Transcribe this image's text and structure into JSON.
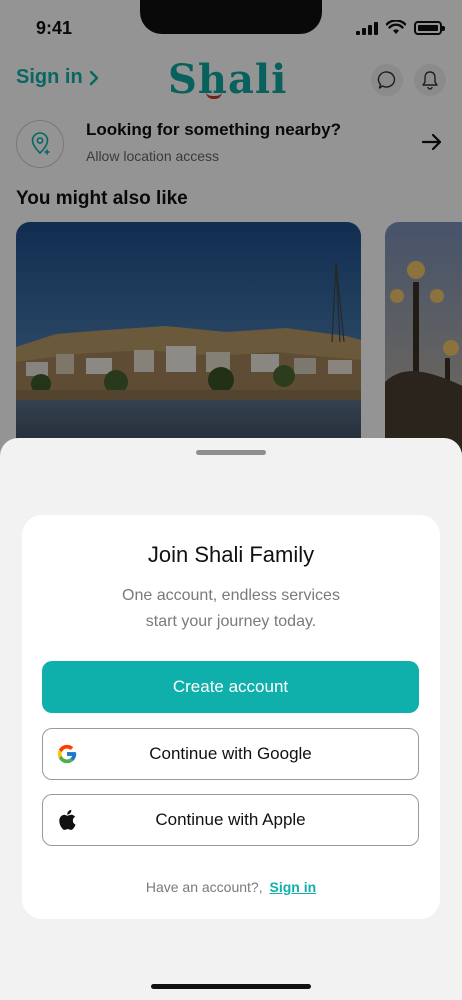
{
  "status": {
    "time": "9:41"
  },
  "header": {
    "signin_label": "Sign in",
    "logo_text": "Shali"
  },
  "location": {
    "title": "Looking for something nearby?",
    "subtitle": "Allow location access"
  },
  "section": {
    "title": "You might also like"
  },
  "sheet": {
    "title": "Join Shali Family",
    "subtitle_line1": "One account, endless services",
    "subtitle_line2": "start your journey today.",
    "create_account_label": "Create account",
    "google_label": "Continue with Google",
    "apple_label": "Continue with Apple",
    "have_account_text": "Have an account?,",
    "signin_link_label": "Sign in"
  },
  "colors": {
    "accent": "#0fb0ab",
    "logo_accent": "#c23a2b"
  }
}
